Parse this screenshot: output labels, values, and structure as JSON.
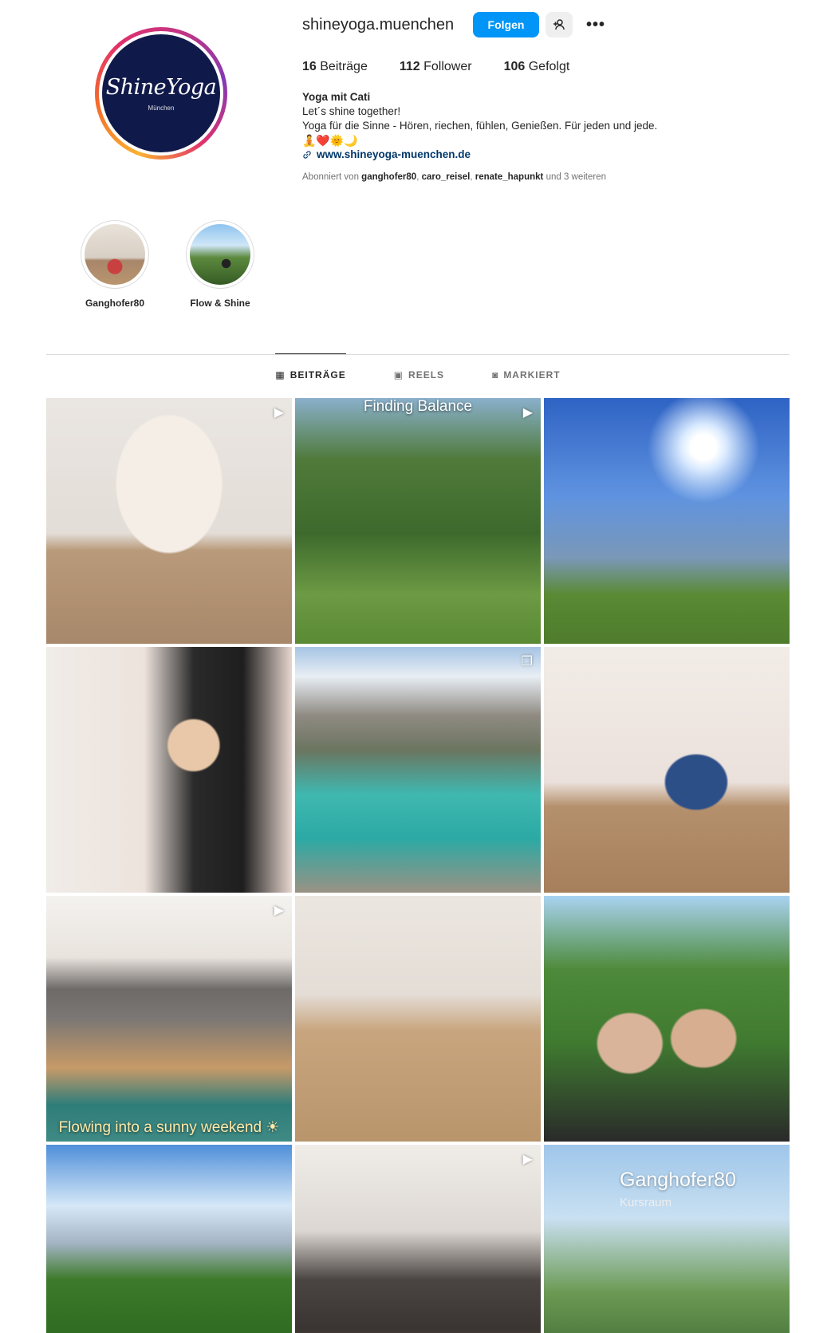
{
  "profile": {
    "username": "shineyoga.muenchen",
    "avatar_text": "ShineYoga",
    "avatar_subtext": "München",
    "follow_label": "Folgen",
    "add_icon": "add-person-icon",
    "more_icon": "more-icon",
    "more_glyph": "•••"
  },
  "stats": {
    "posts_count": "16",
    "posts_label": "Beiträge",
    "followers_count": "112",
    "followers_label": "Follower",
    "following_count": "106",
    "following_label": "Gefolgt"
  },
  "bio": {
    "name": "Yoga mit Cati",
    "line1": "Let´s shine together!",
    "line2": "Yoga für die Sinne - Hören, riechen, fühlen, Genießen. Für jeden und jede.",
    "emojis": "🧘❤️🌞🌙",
    "link": "www.shineyoga-muenchen.de"
  },
  "followed_by": {
    "prefix": "Abonniert von",
    "user1": "ganghofer80",
    "user2": "caro_reisel",
    "user3": "renate_hapunkt",
    "suffix": "und 3 weiteren"
  },
  "highlights": [
    {
      "label": "Ganghofer80"
    },
    {
      "label": "Flow & Shine"
    }
  ],
  "tabs": [
    {
      "label": "BEITRÄGE",
      "icon": "grid-icon",
      "glyph": "▦"
    },
    {
      "label": "REELS",
      "icon": "reels-icon",
      "glyph": "▣"
    },
    {
      "label": "MARKIERT",
      "icon": "tagged-icon",
      "glyph": "◙"
    }
  ],
  "posts": [
    {
      "type": "reel",
      "badge_glyph": "▶"
    },
    {
      "type": "reel",
      "badge_glyph": "▶",
      "caption_top": "Finding Balance"
    },
    {
      "type": "photo"
    },
    {
      "type": "photo"
    },
    {
      "type": "carousel",
      "badge_glyph": "❐"
    },
    {
      "type": "photo"
    },
    {
      "type": "reel",
      "badge_glyph": "▶",
      "caption": "Flowing into a sunny weekend ☀"
    },
    {
      "type": "photo"
    },
    {
      "type": "photo"
    },
    {
      "type": "photo"
    },
    {
      "type": "reel",
      "badge_glyph": "▶"
    },
    {
      "type": "photo",
      "overlay_text": "Ganghofer80",
      "overlay_sub": "Kursraum"
    }
  ],
  "colors": {
    "follow_blue": "#0095f6",
    "link_blue": "#00376b",
    "avatar_navy": "#101a4a"
  }
}
